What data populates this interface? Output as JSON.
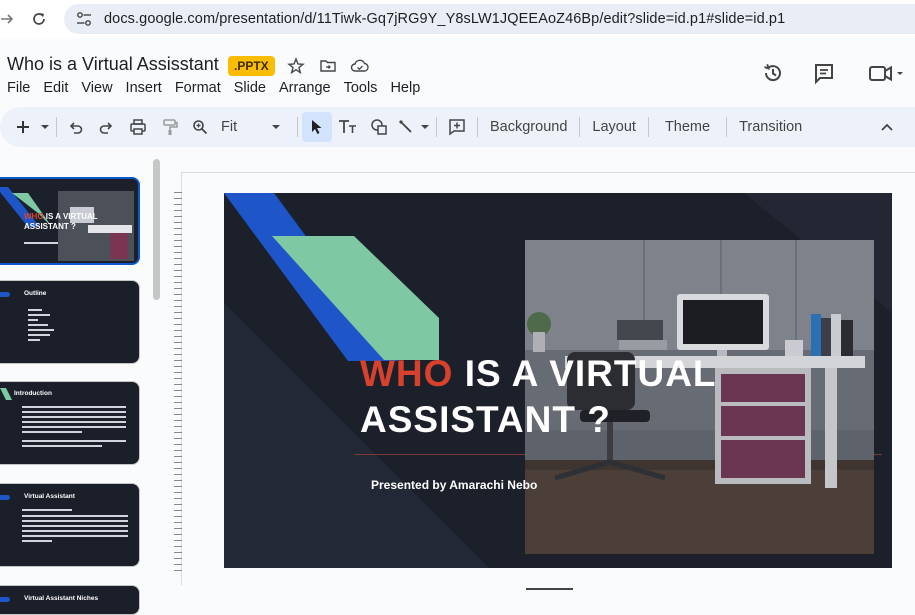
{
  "browser": {
    "url": "docs.google.com/presentation/d/11Tiwk-Gq7jRG9Y_Y8sLW1JQEEAoZ46Bp/edit?slide=id.p1#slide=id.p1"
  },
  "document": {
    "title": "Who is a Virtual Assisstant",
    "badge": ".PPTX"
  },
  "menu": [
    "File",
    "Edit",
    "View",
    "Insert",
    "Format",
    "Slide",
    "Arrange",
    "Tools",
    "Help"
  ],
  "toolbar": {
    "zoom": "Fit",
    "background": "Background",
    "layout": "Layout",
    "theme": "Theme",
    "transition": "Transition"
  },
  "filmstrip": [
    {
      "title": "WHO IS A VIRTUAL ASSISTANT ?",
      "selected": true
    },
    {
      "title": "Outline"
    },
    {
      "title": "Introduction"
    },
    {
      "title": "Virtual Assistant"
    },
    {
      "title": "Virtual Assistant Niches"
    }
  ],
  "slide": {
    "title_accent": "WHO",
    "title_rest": " IS A VIRTUAL",
    "title_line2": "ASSISTANT ?",
    "subtitle": "Presented by Amarachi Nebo"
  },
  "colors": {
    "slide_bg": "#1c202b",
    "accent_red": "#d8422c",
    "stripe_blue": "#1e56c9",
    "stripe_green": "#7ec8a3",
    "selection": "#0b57d0",
    "pptx_badge": "#fbbc04"
  }
}
